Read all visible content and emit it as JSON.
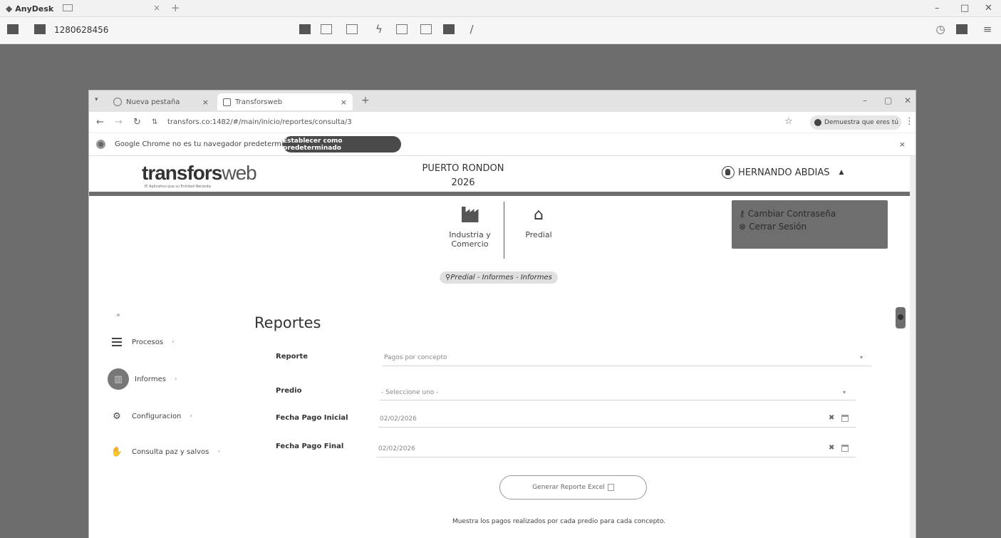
{
  "anydesk": {
    "app_name": "AnyDesk",
    "session_id": "1280628456",
    "window_controls": {
      "minimize": "–",
      "maximize": "□",
      "close": "✕"
    },
    "tab_close": "×",
    "tab_add": "+"
  },
  "browser": {
    "tabs": [
      {
        "label": "Nueva pestaña",
        "close": "×"
      },
      {
        "label": "Transforsweb",
        "close": "×"
      }
    ],
    "new_tab": "+",
    "url": "transfors.co:1482/#/main/inicio/reportes/consulta/3",
    "profile_label": "Demuestra que eres tú",
    "infobar": {
      "message": "Google Chrome no es tu navegador predeterminado",
      "button": "Establecer como predeterminado",
      "close": "×"
    }
  },
  "app": {
    "logo": {
      "brand": "transfors",
      "suffix": "web",
      "tagline": "El Aplicativo que su Entidad Necesita"
    },
    "municipality": "PUERTO RONDON",
    "year": "2026",
    "user": {
      "name": "HERNANDO ABDIAS",
      "caret": "▲"
    },
    "user_menu": [
      {
        "icon": "key-icon",
        "label": "Cambiar Contraseña"
      },
      {
        "icon": "logout-icon",
        "label": "Cerrar Sesión"
      }
    ],
    "modules": [
      {
        "label_line1": "Industria y",
        "label_line2": "Comercio",
        "icon": "factory-icon"
      },
      {
        "label_line1": "Predial",
        "icon": "home-icon"
      }
    ],
    "breadcrumb": "Predial - Informes - Informes",
    "sidebar": {
      "toggle": "«",
      "items": [
        {
          "label": "Procesos",
          "icon": "list-icon"
        },
        {
          "label": "Informes",
          "icon": "chart-icon"
        },
        {
          "label": "Configuracion",
          "icon": "gears-icon"
        },
        {
          "label": "Consulta paz y salvos",
          "icon": "thumbs-up-icon"
        }
      ]
    },
    "form": {
      "title": "Reportes",
      "reporte": {
        "label": "Reporte",
        "value": "Pagos por concepto"
      },
      "predio": {
        "label": "Predio",
        "placeholder": "- Seleccione uno -"
      },
      "fecha_inicial": {
        "label": "Fecha Pago Inicial",
        "value": "02/02/2026"
      },
      "fecha_final": {
        "label": "Fecha Pago Final",
        "value": "02/02/2026"
      },
      "generate_button": "Generar Reporte Excel",
      "description": "Muestra los pagos realizados por cada predio para cada concepto."
    }
  }
}
